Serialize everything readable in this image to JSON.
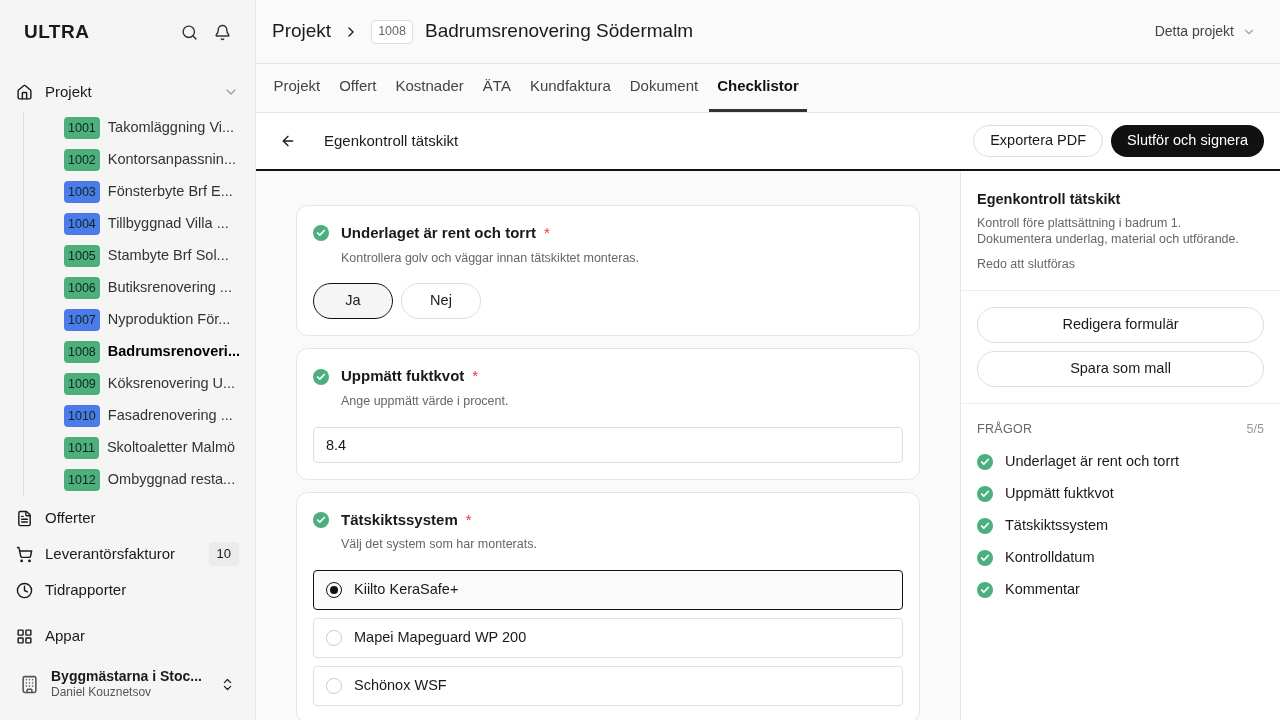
{
  "sidebar": {
    "logo": "ULTRA",
    "projects_label": "Projekt",
    "expanded": true,
    "projects": [
      {
        "number": "1001",
        "name": "Takomläggning Vi...",
        "color": "#4caf7d",
        "selected": false
      },
      {
        "number": "1002",
        "name": "Kontorsanpassnin...",
        "color": "#4caf7d",
        "selected": false
      },
      {
        "number": "1003",
        "name": "Fönsterbyte Brf E...",
        "color": "#4a7be8",
        "selected": false
      },
      {
        "number": "1004",
        "name": "Tillbyggnad Villa ...",
        "color": "#4a7be8",
        "selected": false
      },
      {
        "number": "1005",
        "name": "Stambyte Brf Sol...",
        "color": "#4caf7d",
        "selected": false
      },
      {
        "number": "1006",
        "name": "Butiksrenovering ...",
        "color": "#4caf7d",
        "selected": false
      },
      {
        "number": "1007",
        "name": "Nyproduktion För...",
        "color": "#4a7be8",
        "selected": false
      },
      {
        "number": "1008",
        "name": "Badrumsrenoveri...",
        "color": "#4caf7d",
        "selected": true
      },
      {
        "number": "1009",
        "name": "Köksrenovering U...",
        "color": "#4caf7d",
        "selected": false
      },
      {
        "number": "1010",
        "name": "Fasadrenovering ...",
        "color": "#4a7be8",
        "selected": false
      },
      {
        "number": "1011",
        "name": "Skoltoaletter Malmö",
        "color": "#4caf7d",
        "selected": false
      },
      {
        "number": "1012",
        "name": "Ombyggnad resta...",
        "color": "#4caf7d",
        "selected": false
      }
    ],
    "nav": [
      {
        "kind": "document",
        "label": "Offerter"
      },
      {
        "kind": "cart",
        "label": "Leverantörsfakturor",
        "badge": "10"
      },
      {
        "kind": "clock",
        "label": "Tidrapporter"
      }
    ],
    "apps": "Appar",
    "org": "Byggmästarna i Stoc...",
    "user": "Daniel Kouznetsov"
  },
  "header": {
    "breadcrumb": "Projekt",
    "number": "1008",
    "title": "Badrumsrenovering Södermalm",
    "scope": "Detta projekt"
  },
  "tabs": [
    {
      "label": "Projekt",
      "selected": false
    },
    {
      "label": "Offert",
      "selected": false
    },
    {
      "label": "Kostnader",
      "selected": false
    },
    {
      "label": "ÄTA",
      "selected": false
    },
    {
      "label": "Kundfaktura",
      "selected": false
    },
    {
      "label": "Dokument",
      "selected": false
    },
    {
      "label": "Checklistor",
      "selected": true
    }
  ],
  "toolbar": {
    "title": "Egenkontroll tätskikt",
    "export": "Exportera PDF",
    "finish": "Slutför och signera"
  },
  "questions": [
    {
      "kind": "choice",
      "title": "Underlaget är rent och torrt",
      "required": "*",
      "done": true,
      "hint": "Kontrollera golv och väggar innan tätskiktet monteras.",
      "options": [
        {
          "label": "Ja",
          "selected": true
        },
        {
          "label": "Nej",
          "selected": false
        }
      ]
    },
    {
      "kind": "number",
      "title": "Uppmätt fuktkvot",
      "required": "*",
      "done": true,
      "hint": "Ange uppmätt värde i procent.",
      "value": "8.4"
    },
    {
      "kind": "radio",
      "title": "Tätskiktssystem",
      "required": "*",
      "done": true,
      "hint": "Välj det system som har monterats.",
      "options": [
        {
          "label": "Kiilto KeraSafe+",
          "selected": true
        },
        {
          "label": "Mapei Mapeguard WP 200",
          "selected": false
        },
        {
          "label": "Schönox WSF",
          "selected": false
        }
      ]
    }
  ],
  "panel": {
    "title": "Egenkontroll tätskikt",
    "description": "Kontroll före plattsättning i badrum 1.\nDokumentera underlag, material och utförande.",
    "status": "Redo att slutföras",
    "buttons": [
      "Redigera formulär",
      "Spara som mall"
    ],
    "questions_label": "FRÅGOR",
    "count": "5/5",
    "items": [
      {
        "label": "Underlaget är rent och torrt",
        "done": true
      },
      {
        "label": "Uppmätt fuktkvot",
        "done": true
      },
      {
        "label": "Tätskiktssystem",
        "done": true
      },
      {
        "label": "Kontrolldatum",
        "done": true
      },
      {
        "label": "Kommentar",
        "done": true
      }
    ]
  }
}
